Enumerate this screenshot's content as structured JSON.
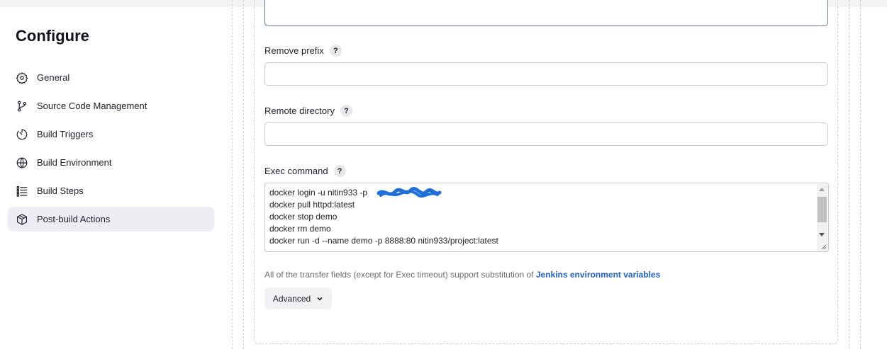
{
  "sidebar": {
    "title": "Configure",
    "items": [
      {
        "label": "General",
        "icon": "gear-icon"
      },
      {
        "label": "Source Code Management",
        "icon": "branch-icon"
      },
      {
        "label": "Build Triggers",
        "icon": "timer-icon"
      },
      {
        "label": "Build Environment",
        "icon": "globe-icon"
      },
      {
        "label": "Build Steps",
        "icon": "list-icon"
      },
      {
        "label": "Post-build Actions",
        "icon": "package-icon",
        "active": true
      }
    ]
  },
  "form": {
    "remove_prefix": {
      "label": "Remove prefix",
      "help": "?",
      "value": ""
    },
    "remote_directory": {
      "label": "Remote directory",
      "help": "?",
      "value": ""
    },
    "exec_command": {
      "label": "Exec command",
      "help": "?",
      "lines": [
        "docker login -u nitin933 -p",
        "docker pull httpd:latest",
        "docker stop demo",
        "docker rm demo",
        "docker run -d --name demo -p 8888:80 nitin933/project:latest"
      ]
    },
    "note_text": "All of the transfer fields (except for Exec timeout) support substitution of ",
    "note_link": "Jenkins environment variables",
    "advanced_button": "Advanced"
  },
  "colors": {
    "accent_link": "#1d5fd6",
    "redaction": "#1e6fd9",
    "active_item_bg": "#eceef3"
  }
}
